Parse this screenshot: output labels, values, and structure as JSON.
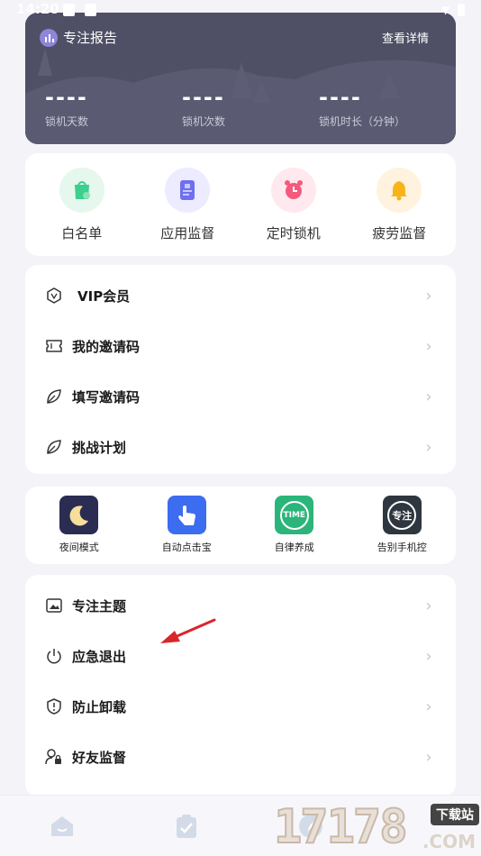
{
  "status": {
    "time": "14:20"
  },
  "report": {
    "title": "专注报告",
    "detail_link": "查看详情",
    "stats": [
      {
        "value": "----",
        "label": "锁机天数"
      },
      {
        "value": "----",
        "label": "锁机次数"
      },
      {
        "value": "----",
        "label": "锁机时长（分钟）"
      }
    ]
  },
  "quick_actions": [
    {
      "label": "白名单",
      "icon": "whitelist-icon",
      "color": "#e6f7ee"
    },
    {
      "label": "应用监督",
      "icon": "app-monitor-icon",
      "color": "#ecebff"
    },
    {
      "label": "定时锁机",
      "icon": "alarm-clock-icon",
      "color": "#ffe9ee"
    },
    {
      "label": "疲劳监督",
      "icon": "bell-icon",
      "color": "#fff3df"
    }
  ],
  "menu1": [
    {
      "label": "VIP会员",
      "icon": "vip-shield-icon"
    },
    {
      "label": "我的邀请码",
      "icon": "ticket-icon"
    },
    {
      "label": "填写邀请码",
      "icon": "leaf-icon"
    },
    {
      "label": "挑战计划",
      "icon": "leaf-icon"
    }
  ],
  "tools": [
    {
      "label": "夜间模式",
      "icon": "moon-app-icon",
      "text": ""
    },
    {
      "label": "自动点击宝",
      "icon": "tap-hand-app-icon",
      "text": ""
    },
    {
      "label": "自律养成",
      "icon": "time-app-icon",
      "text": "TIME"
    },
    {
      "label": "告别手机控",
      "icon": "focus-app-icon",
      "text": "专注"
    }
  ],
  "menu2": [
    {
      "label": "专注主题",
      "icon": "image-frame-icon"
    },
    {
      "label": "应急退出",
      "icon": "power-icon"
    },
    {
      "label": "防止卸载",
      "icon": "shield-alert-icon"
    },
    {
      "label": "好友监督",
      "icon": "user-lock-icon"
    }
  ],
  "watermark": {
    "big": "17178",
    "site": "下载站",
    "domain": ".COM"
  },
  "colors": {
    "report_bg": "#505068",
    "accent": "#8e86d8",
    "arrow": "#d8262b"
  }
}
